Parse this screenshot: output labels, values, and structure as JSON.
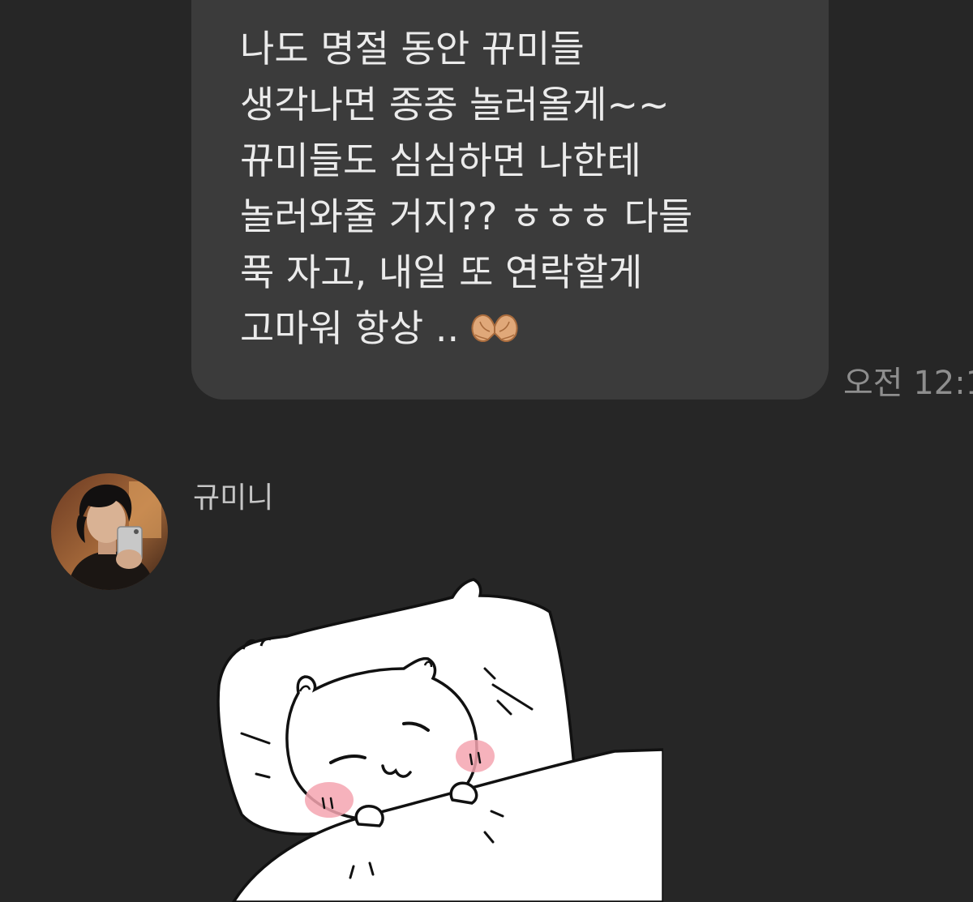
{
  "conversation": {
    "outgoing_message": {
      "text": "나도 명절 동안 뀨미들\n생각나면 종종 놀러올게~~\n뀨미들도 심심하면 나한테\n놀러와줄 거지?? ㅎㅎㅎ 다들\n푹 자고, 내일 또 연락할게\n고마워 항상 ..",
      "emoji": "heart-hands-icon",
      "timestamp": "오전 12:1"
    },
    "incoming_message": {
      "sender_name": "규미니",
      "avatar": "profile-photo",
      "sticker": "sleeping-cat-sticker"
    }
  },
  "colors": {
    "background": "#262626",
    "bubble": "#3b3b3b",
    "bubble_text": "#ebebeb",
    "timestamp": "#8e8e8e",
    "sender_name": "#c6c6c6",
    "blush": "#f4a4b0"
  }
}
